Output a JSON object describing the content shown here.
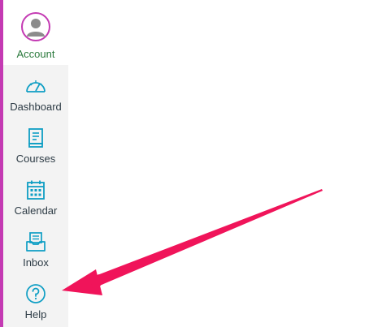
{
  "nav": {
    "account_label": "Account",
    "items": [
      {
        "label": "Dashboard",
        "icon": "dashboard-icon"
      },
      {
        "label": "Courses",
        "icon": "courses-icon"
      },
      {
        "label": "Calendar",
        "icon": "calendar-icon"
      },
      {
        "label": "Inbox",
        "icon": "inbox-icon"
      },
      {
        "label": "Help",
        "icon": "help-icon"
      }
    ]
  },
  "annotation": {
    "icon": "arrow-icon"
  },
  "colors": {
    "accent_edge": "#c43ab3",
    "icon": "#0e9ec4",
    "account_label": "#2b7a3d",
    "arrow": "#f0145a",
    "nav_bg": "#f3f3f3"
  }
}
